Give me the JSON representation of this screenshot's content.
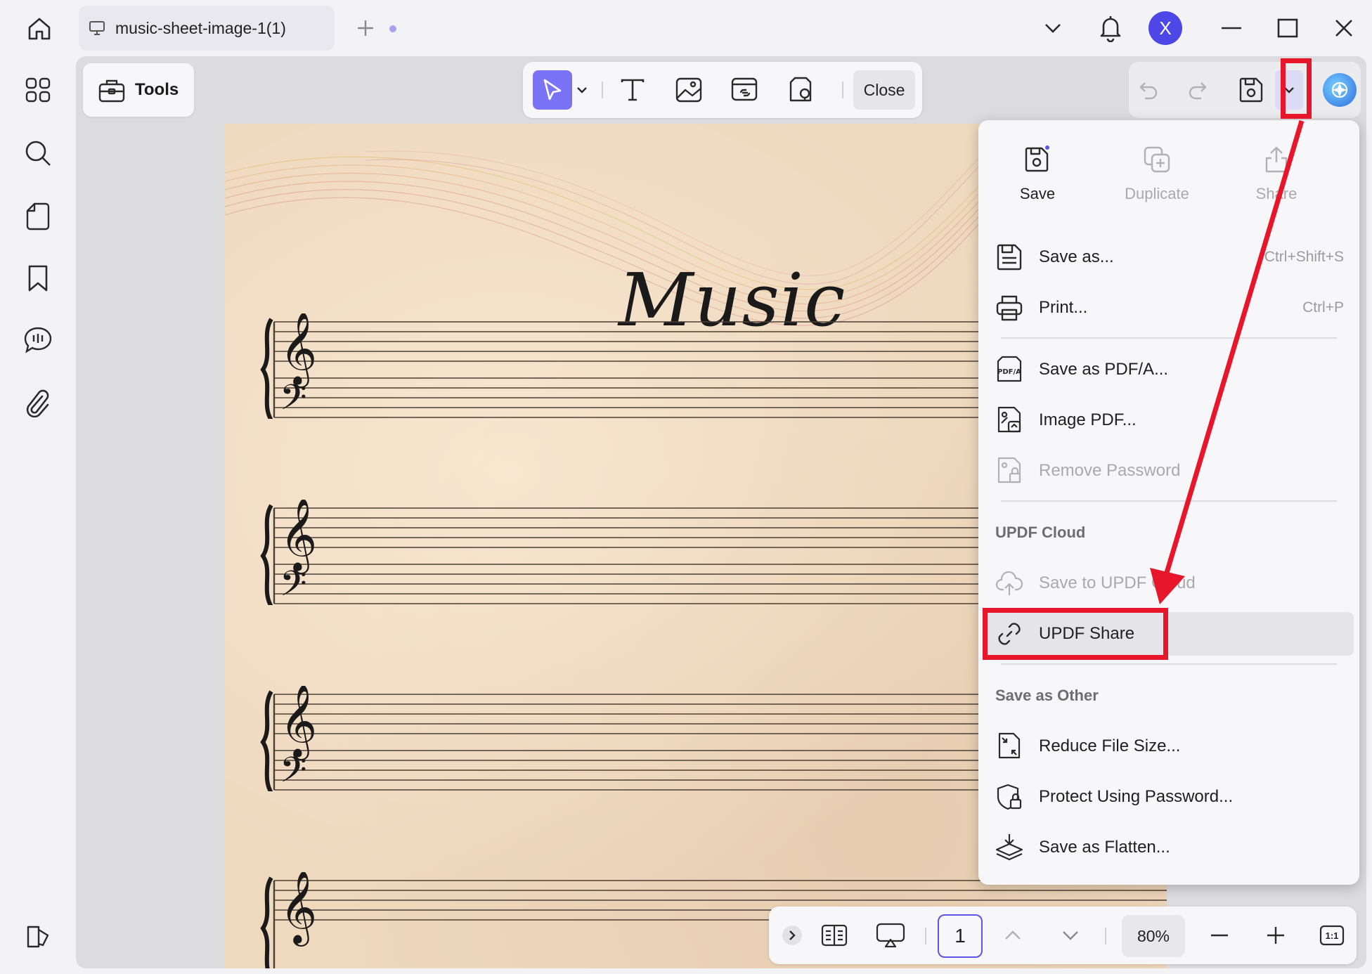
{
  "titlebar": {
    "tab_title": "music-sheet-image-1(1)",
    "avatar_letter": "X"
  },
  "toolbar": {
    "tools_label": "Tools",
    "close_label": "Close"
  },
  "document": {
    "title": "Music"
  },
  "menu": {
    "top_buttons": [
      {
        "label": "Save",
        "icon": "save-icon",
        "enabled": true
      },
      {
        "label": "Duplicate",
        "icon": "duplicate-icon",
        "enabled": false
      },
      {
        "label": "Share",
        "icon": "share-icon",
        "enabled": false
      }
    ],
    "items": [
      {
        "label": "Save as...",
        "shortcut": "Ctrl+Shift+S",
        "icon": "save-as-icon"
      },
      {
        "label": "Print...",
        "shortcut": "Ctrl+P",
        "icon": "printer-icon"
      },
      {
        "label": "Save as PDF/A...",
        "icon": "pdfa-icon"
      },
      {
        "label": "Image PDF...",
        "icon": "image-pdf-icon"
      },
      {
        "label": "Remove Password",
        "icon": "remove-password-icon",
        "enabled": false
      }
    ],
    "cloud_section": "UPDF Cloud",
    "cloud_items": [
      {
        "label": "Save to UPDF Cloud",
        "icon": "cloud-upload-icon",
        "enabled": false
      },
      {
        "label": "UPDF Share",
        "icon": "link-icon"
      }
    ],
    "other_section": "Save as Other",
    "other_items": [
      {
        "label": "Reduce File Size...",
        "icon": "reduce-size-icon"
      },
      {
        "label": "Protect Using Password...",
        "icon": "shield-lock-icon"
      },
      {
        "label": "Save as Flatten...",
        "icon": "flatten-icon"
      }
    ]
  },
  "bottom_bar": {
    "page_number": "1",
    "zoom": "80%",
    "actual_size_label": "1:1"
  },
  "colors": {
    "accent": "#7b73f5",
    "highlight": "#e8162a",
    "avatar": "#4e47e8"
  }
}
